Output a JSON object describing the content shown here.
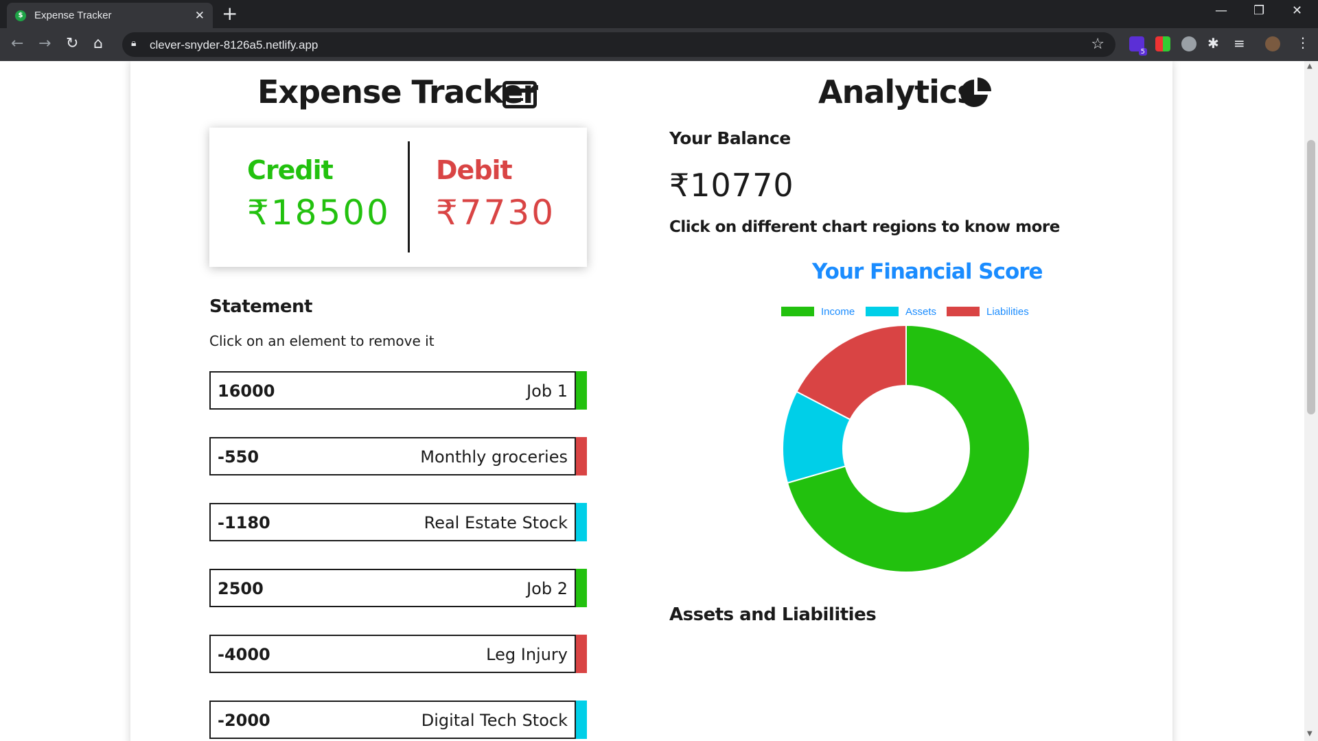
{
  "browser": {
    "tab_title": "Expense Tracker",
    "url": "clever-snyder-8126a5.netlify.app",
    "extension_badge": "5"
  },
  "tracker": {
    "title": "Expense Tracker",
    "credit_label": "Credit",
    "credit_value": "₹18500",
    "debit_label": "Debit",
    "debit_value": "₹7730",
    "statement_title": "Statement",
    "statement_hint": "Click on an element to remove it",
    "entries": [
      {
        "amount": "16000",
        "description": "Job 1",
        "category": "Income"
      },
      {
        "amount": "-550",
        "description": "Monthly groceries",
        "category": "Liabilities"
      },
      {
        "amount": "-1180",
        "description": "Real Estate Stock",
        "category": "Assets"
      },
      {
        "amount": "2500",
        "description": "Job 2",
        "category": "Income"
      },
      {
        "amount": "-4000",
        "description": "Leg Injury",
        "category": "Liabilities"
      },
      {
        "amount": "-2000",
        "description": "Digital Tech Stock",
        "category": "Assets"
      }
    ]
  },
  "analytics": {
    "title": "Analytics",
    "balance_label": "Your Balance",
    "balance_value": "₹10770",
    "hint": "Click on different chart regions to know more",
    "assets_title": "Assets and Liabilities"
  },
  "colors": {
    "income": "#22c10e",
    "assets": "#00cfe8",
    "liabilities": "#d94444",
    "link_blue": "#1a8cff"
  },
  "chart_data": {
    "type": "pie",
    "title": "Your Financial Score",
    "donut": true,
    "legend_position": "top",
    "categories": [
      "Income",
      "Assets",
      "Liabilities"
    ],
    "values": [
      18500,
      3180,
      4550
    ],
    "colors": [
      "#22c10e",
      "#00cfe8",
      "#d94444"
    ]
  }
}
